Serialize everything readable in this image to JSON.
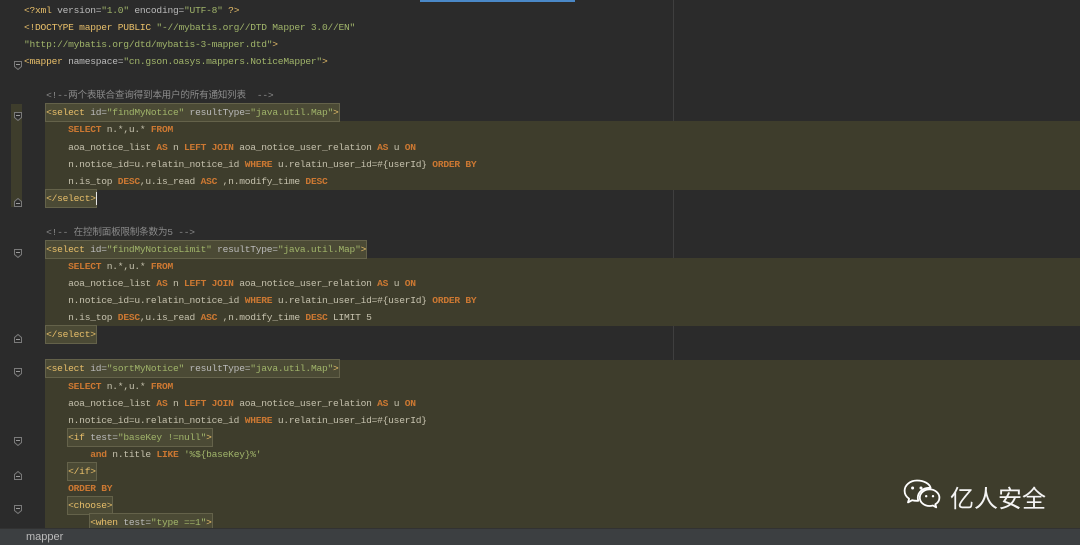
{
  "theme": {
    "background": "#2b2b2b",
    "tag": "#e8bf6a",
    "attribute": "#bababa",
    "value": "#a0b46a",
    "keyword": "#cc7832",
    "comment": "#8a8a8a",
    "injected_highlight": "#3e3d2c",
    "status_bar": "#3c3f41"
  },
  "editor": {
    "lines": [
      {
        "lead": "",
        "tokens": [
          {
            "type": "tag",
            "text": "<?xml"
          },
          {
            "type": "attr",
            "text": " version="
          },
          {
            "type": "str",
            "text": "\"1.0\""
          },
          {
            "type": "attr",
            "text": " encoding="
          },
          {
            "type": "str",
            "text": "\"UTF-8\""
          },
          {
            "type": "tag",
            "text": " ?>"
          }
        ]
      },
      {
        "lead": "",
        "tokens": [
          {
            "type": "tag",
            "text": "<!DOCTYPE mapper PUBLIC"
          },
          {
            "type": "str",
            "text": " \"-//mybatis.org//DTD Mapper 3.0//EN\""
          }
        ]
      },
      {
        "lead": "",
        "tokens": [
          {
            "type": "str",
            "text": "\"http://mybatis.org/dtd/mybatis-3-mapper.dtd\""
          },
          {
            "type": "tag",
            "text": ">"
          }
        ]
      },
      {
        "lead": "",
        "fold": "open",
        "tokens": [
          {
            "type": "tag",
            "text": "<mapper"
          },
          {
            "type": "attr",
            "text": " namespace="
          },
          {
            "type": "str",
            "text": "\"cn.gson.oasys.mappers.NoticeMapper\""
          },
          {
            "type": "tag",
            "text": ">"
          }
        ]
      },
      {
        "lead": "",
        "tokens": []
      },
      {
        "lead": "    ",
        "tokens": [
          {
            "type": "cmt",
            "text": "<!--两个表联合查询得到本用户的所有通知列表  -->"
          }
        ]
      },
      {
        "lead": "    ",
        "boxed": true,
        "scope": true,
        "fold": "open",
        "tokens": [
          {
            "type": "tag",
            "text": "<select"
          },
          {
            "type": "attr",
            "text": " id="
          },
          {
            "type": "str",
            "text": "\"findMyNotice\""
          },
          {
            "type": "attr",
            "text": " resultType="
          },
          {
            "type": "str",
            "text": "\"java.util.Map\""
          },
          {
            "type": "tag",
            "text": ">"
          }
        ]
      },
      {
        "lead": "        ",
        "region": "sql",
        "scope": true,
        "tokens": [
          {
            "type": "kw",
            "text": "SELECT"
          },
          {
            "type": "plain",
            "text": " n.*,u.* "
          },
          {
            "type": "kw",
            "text": "FROM"
          }
        ]
      },
      {
        "lead": "        ",
        "region": "sql",
        "scope": true,
        "tokens": [
          {
            "type": "plain",
            "text": "aoa_notice_list "
          },
          {
            "type": "kw",
            "text": "AS"
          },
          {
            "type": "plain",
            "text": " n "
          },
          {
            "type": "kw",
            "text": "LEFT JOIN"
          },
          {
            "type": "plain",
            "text": " aoa_notice_user_relation "
          },
          {
            "type": "kw",
            "text": "AS"
          },
          {
            "type": "plain",
            "text": " u "
          },
          {
            "type": "kw",
            "text": "ON"
          }
        ]
      },
      {
        "lead": "        ",
        "region": "sql",
        "scope": true,
        "tokens": [
          {
            "type": "plain",
            "text": "n.notice_id=u.relatin_notice_id "
          },
          {
            "type": "kw",
            "text": "WHERE"
          },
          {
            "type": "plain",
            "text": " u.relatin_user_id=#{userId} "
          },
          {
            "type": "kw",
            "text": "ORDER BY"
          }
        ]
      },
      {
        "lead": "        ",
        "region": "sql",
        "scope": true,
        "tokens": [
          {
            "type": "plain",
            "text": "n.is_top "
          },
          {
            "type": "kw",
            "text": "DESC"
          },
          {
            "type": "plain",
            "text": ",u.is_read "
          },
          {
            "type": "kw",
            "text": "ASC"
          },
          {
            "type": "plain",
            "text": " ,n.modify_time "
          },
          {
            "type": "kw",
            "text": "DESC"
          }
        ]
      },
      {
        "lead": "    ",
        "boxed": true,
        "scope": true,
        "caret": true,
        "fold": "close",
        "tokens": [
          {
            "type": "tag",
            "text": "</select>"
          }
        ]
      },
      {
        "lead": "",
        "tokens": []
      },
      {
        "lead": "    ",
        "tokens": [
          {
            "type": "cmt",
            "text": "<!-- 在控制面板限制条数为5 -->"
          }
        ]
      },
      {
        "lead": "    ",
        "boxed": true,
        "fold": "open",
        "tokens": [
          {
            "type": "tag",
            "text": "<select"
          },
          {
            "type": "attr",
            "text": " id="
          },
          {
            "type": "str",
            "text": "\"findMyNoticeLimit\""
          },
          {
            "type": "attr",
            "text": " resultType="
          },
          {
            "type": "str",
            "text": "\"java.util.Map\""
          },
          {
            "type": "tag",
            "text": ">"
          }
        ]
      },
      {
        "lead": "        ",
        "region": "sql",
        "tokens": [
          {
            "type": "kw",
            "text": "SELECT"
          },
          {
            "type": "plain",
            "text": " n.*,u.* "
          },
          {
            "type": "kw",
            "text": "FROM"
          }
        ]
      },
      {
        "lead": "        ",
        "region": "sql",
        "tokens": [
          {
            "type": "plain",
            "text": "aoa_notice_list "
          },
          {
            "type": "kw",
            "text": "AS"
          },
          {
            "type": "plain",
            "text": " n "
          },
          {
            "type": "kw",
            "text": "LEFT JOIN"
          },
          {
            "type": "plain",
            "text": " aoa_notice_user_relation "
          },
          {
            "type": "kw",
            "text": "AS"
          },
          {
            "type": "plain",
            "text": " u "
          },
          {
            "type": "kw",
            "text": "ON"
          }
        ]
      },
      {
        "lead": "        ",
        "region": "sql",
        "tokens": [
          {
            "type": "plain",
            "text": "n.notice_id=u.relatin_notice_id "
          },
          {
            "type": "kw",
            "text": "WHERE"
          },
          {
            "type": "plain",
            "text": " u.relatin_user_id=#{userId} "
          },
          {
            "type": "kw",
            "text": "ORDER BY"
          }
        ]
      },
      {
        "lead": "        ",
        "region": "sql",
        "tokens": [
          {
            "type": "plain",
            "text": "n.is_top "
          },
          {
            "type": "kw",
            "text": "DESC"
          },
          {
            "type": "plain",
            "text": ",u.is_read "
          },
          {
            "type": "kw",
            "text": "ASC"
          },
          {
            "type": "plain",
            "text": " ,n.modify_time "
          },
          {
            "type": "kw",
            "text": "DESC"
          },
          {
            "type": "plain",
            "text": " LIMIT 5"
          }
        ]
      },
      {
        "lead": "    ",
        "boxed": true,
        "fold": "close",
        "tokens": [
          {
            "type": "tag",
            "text": "</select>"
          }
        ]
      },
      {
        "lead": "",
        "tokens": []
      },
      {
        "lead": "    ",
        "boxed": true,
        "region": "sql",
        "fold": "open",
        "tokens": [
          {
            "type": "tag",
            "text": "<select"
          },
          {
            "type": "attr",
            "text": " id="
          },
          {
            "type": "str",
            "text": "\"sortMyNotice\""
          },
          {
            "type": "attr",
            "text": " resultType="
          },
          {
            "type": "str",
            "text": "\"java.util.Map\""
          },
          {
            "type": "tag",
            "text": ">"
          }
        ]
      },
      {
        "lead": "        ",
        "region": "sql",
        "tokens": [
          {
            "type": "kw",
            "text": "SELECT"
          },
          {
            "type": "plain",
            "text": " n.*,u.* "
          },
          {
            "type": "kw",
            "text": "FROM"
          }
        ]
      },
      {
        "lead": "        ",
        "region": "sql",
        "tokens": [
          {
            "type": "plain",
            "text": "aoa_notice_list "
          },
          {
            "type": "kw",
            "text": "AS"
          },
          {
            "type": "plain",
            "text": " n "
          },
          {
            "type": "kw",
            "text": "LEFT JOIN"
          },
          {
            "type": "plain",
            "text": " aoa_notice_user_relation "
          },
          {
            "type": "kw",
            "text": "AS"
          },
          {
            "type": "plain",
            "text": " u "
          },
          {
            "type": "kw",
            "text": "ON"
          }
        ]
      },
      {
        "lead": "        ",
        "region": "sql",
        "tokens": [
          {
            "type": "plain",
            "text": "n.notice_id=u.relatin_notice_id "
          },
          {
            "type": "kw",
            "text": "WHERE"
          },
          {
            "type": "plain",
            "text": " u.relatin_user_id=#{userId}"
          }
        ]
      },
      {
        "lead": "        ",
        "boxed": true,
        "region": "sql",
        "fold": "open",
        "tokens": [
          {
            "type": "tag",
            "text": "<if"
          },
          {
            "type": "attr",
            "text": " test="
          },
          {
            "type": "str",
            "text": "\"baseKey !=null\""
          },
          {
            "type": "tag",
            "text": ">"
          }
        ]
      },
      {
        "lead": "            ",
        "region": "sql",
        "tokens": [
          {
            "type": "kw",
            "text": "and"
          },
          {
            "type": "plain",
            "text": " n.title "
          },
          {
            "type": "kw",
            "text": "LIKE"
          },
          {
            "type": "str",
            "text": " '%${baseKey}%'"
          }
        ]
      },
      {
        "lead": "        ",
        "boxed": true,
        "region": "sql",
        "fold": "close",
        "tokens": [
          {
            "type": "tag",
            "text": "</if>"
          }
        ]
      },
      {
        "lead": "        ",
        "region": "sql",
        "tokens": [
          {
            "type": "kw",
            "text": "ORDER BY"
          }
        ]
      },
      {
        "lead": "        ",
        "boxed": true,
        "region": "sql",
        "fold": "open",
        "tokens": [
          {
            "type": "tag",
            "text": "<choose>"
          }
        ]
      },
      {
        "lead": "            ",
        "boxed": true,
        "region": "sql",
        "tokens": [
          {
            "type": "tag",
            "text": "<when"
          },
          {
            "type": "attr",
            "text": " test="
          },
          {
            "type": "str",
            "text": "\"type ==1\""
          },
          {
            "type": "tag",
            "text": ">"
          }
        ]
      }
    ]
  },
  "statusbar": {
    "breadcrumb": "mapper"
  },
  "watermark": {
    "icon": "wechat-icon",
    "text": "亿人安全"
  }
}
